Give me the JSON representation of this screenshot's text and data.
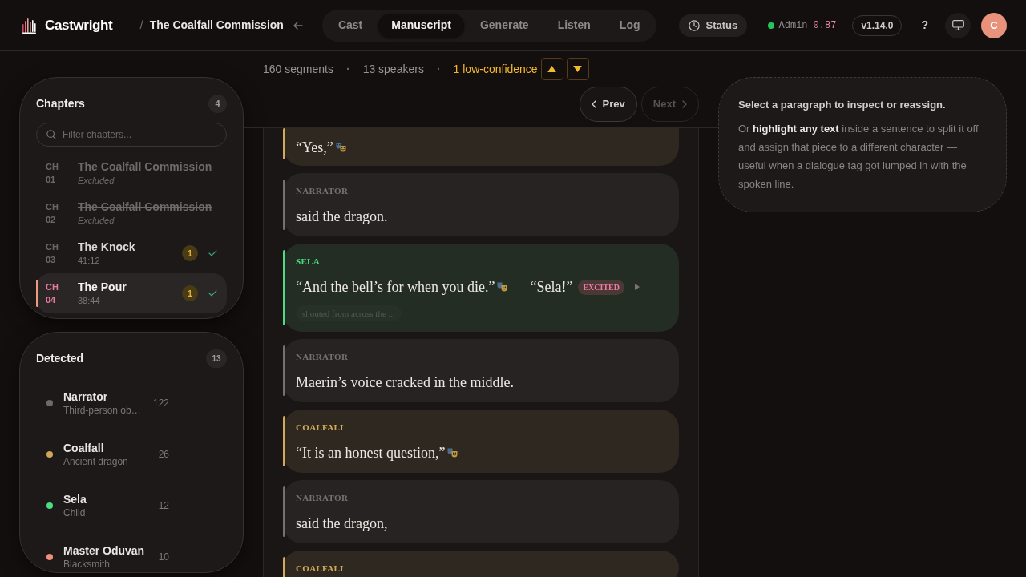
{
  "header": {
    "app_name": "Castwright",
    "breadcrumb_separator": "/",
    "project": "The Coalfall Commission",
    "tabs": [
      {
        "label": "Cast",
        "selected": false
      },
      {
        "label": "Manuscript",
        "selected": true
      },
      {
        "label": "Generate",
        "selected": false
      },
      {
        "label": "Listen",
        "selected": false
      },
      {
        "label": "Log",
        "selected": false
      }
    ],
    "status_button": "Status",
    "user": {
      "online": true,
      "role": "Admin",
      "score": "0.87"
    },
    "version": "v1.14.0",
    "help": "?",
    "avatar": "C"
  },
  "chapters": {
    "title": "Chapters",
    "count": "4",
    "filter": {
      "placeholder": "Filter chapters..."
    },
    "items": [
      {
        "label": "CH 01",
        "title": "The Coalfall Commission",
        "subtitle": "Excluded",
        "excluded": true,
        "selected": false,
        "complete": false
      },
      {
        "label": "CH 02",
        "title": "The Coalfall Commission",
        "subtitle": "Excluded",
        "excluded": true,
        "selected": false,
        "complete": false
      },
      {
        "label": "CH 03",
        "title": "The Knock",
        "subtitle": "41:12",
        "badge": "1",
        "excluded": false,
        "selected": false,
        "complete": true
      },
      {
        "label": "CH 04",
        "title": "The Pour",
        "subtitle": "38:44",
        "badge": "1",
        "excluded": false,
        "selected": true,
        "complete": true
      }
    ]
  },
  "detected": {
    "title": "Detected",
    "count": "13",
    "speakers": [
      {
        "name": "Narrator",
        "description": "Third-person ob…",
        "count": "122",
        "color": "#6e6a69"
      },
      {
        "name": "Coalfall",
        "description": "Ancient dragon",
        "count": "26",
        "color": "#cfa658"
      },
      {
        "name": "Sela",
        "description": "Child",
        "count": "12",
        "color": "#4ade80"
      },
      {
        "name": "Master Oduvan",
        "description": "Blacksmith",
        "count": "10",
        "color": "#f0907a"
      }
    ]
  },
  "stats": [
    {
      "kind": "count",
      "text": "160 segments"
    },
    {
      "kind": "separator",
      "text": "·"
    },
    {
      "kind": "count",
      "text": "13 speakers"
    },
    {
      "kind": "separator",
      "text": "·"
    },
    {
      "kind": "warning",
      "text": "1 low-confidence"
    }
  ],
  "pager": [
    {
      "kind": "prev",
      "label": "Prev",
      "disabled": false
    },
    {
      "kind": "next",
      "label": "Next",
      "disabled": true
    }
  ],
  "segments": [
    {
      "color": "#d4aa5a",
      "pieces": [
        {
          "text": "“Yes,”",
          "masks": true
        }
      ]
    },
    {
      "speaker": "NARRATOR",
      "color": "#767070",
      "pieces": [
        {
          "text": "said the dragon.",
          "masks": false
        }
      ]
    },
    {
      "speaker": "SELA",
      "color": "#4ade80",
      "pieces": [
        {
          "text": "“And the bell’s for when you die.”",
          "masks": true
        },
        {
          "text": "“Sela!”",
          "masks": false,
          "tag": "EXCITED",
          "playable": true
        }
      ],
      "note": "shouted from across the ..."
    },
    {
      "speaker": "NARRATOR",
      "color": "#767070",
      "pieces": [
        {
          "text": "Maerin’s voice cracked in the middle.",
          "masks": false
        }
      ]
    },
    {
      "speaker": "COALFALL",
      "color": "#d4aa5a",
      "pieces": [
        {
          "text": "“It is an honest question,”",
          "masks": true
        }
      ]
    },
    {
      "speaker": "NARRATOR",
      "color": "#767070",
      "pieces": [
        {
          "text": "said the dragon,",
          "masks": false
        }
      ]
    },
    {
      "speaker": "COALFALL",
      "color": "#d4aa5a"
    }
  ],
  "hint": {
    "title": "Select a paragraph to inspect or reassign.",
    "body": "Or **highlight any text** inside a sentence to split it off and assign that piece to a different character — useful when a dialogue tag got lumped in with the spoken line."
  }
}
